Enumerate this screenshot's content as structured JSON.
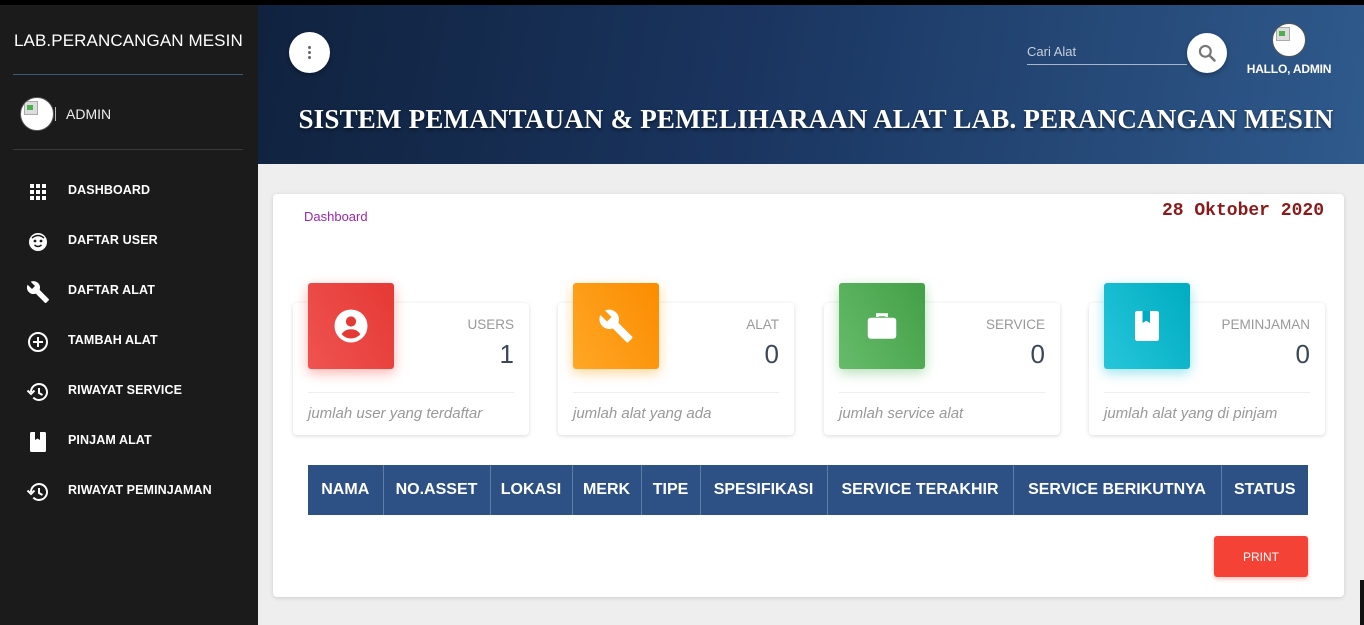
{
  "sidebar": {
    "brand": "LAB.PERANCANGAN MESIN",
    "user_name": "ADMIN",
    "items": [
      {
        "label": "DASHBOARD",
        "icon": "grid-icon"
      },
      {
        "label": "DAFTAR USER",
        "icon": "face-icon"
      },
      {
        "label": "DAFTAR ALAT",
        "icon": "wrench-icon"
      },
      {
        "label": "TAMBAH ALAT",
        "icon": "add-circle-icon"
      },
      {
        "label": "RIWAYAT SERVICE",
        "icon": "history-icon"
      },
      {
        "label": "PINJAM ALAT",
        "icon": "book-icon"
      },
      {
        "label": "RIWAYAT PEMINJAMAN",
        "icon": "history-icon"
      }
    ]
  },
  "header": {
    "search_placeholder": "Cari Alat",
    "profile_label": "HALLO, ADMIN",
    "title": "SISTEM PEMANTAUAN & PEMELIHARAAN ALAT LAB. PERANCANGAN MESIN"
  },
  "main": {
    "breadcrumb": "Dashboard",
    "date": "28 Oktober 2020",
    "cards": [
      {
        "category": "USERS",
        "value": "1",
        "footer": "jumlah user yang terdaftar",
        "icon": "user-icon",
        "color": "#e53935"
      },
      {
        "category": "ALAT",
        "value": "0",
        "footer": "jumlah alat yang ada",
        "icon": "wrench-icon",
        "color": "#fb8c00"
      },
      {
        "category": "SERVICE",
        "value": "0",
        "footer": "jumlah service alat",
        "icon": "briefcase-icon",
        "color": "#43a047"
      },
      {
        "category": "PEMINJAMAN",
        "value": "0",
        "footer": "jumlah alat yang di pinjam",
        "icon": "book-icon",
        "color": "#00acc1"
      }
    ],
    "table_headers": [
      "NAMA",
      "NO.ASSET",
      "LOKASI",
      "MERK",
      "TIPE",
      "SPESIFIKASI",
      "SERVICE TERAKHIR",
      "SERVICE BERIKUTNYA",
      "STATUS"
    ],
    "print_label": "PRINT"
  }
}
